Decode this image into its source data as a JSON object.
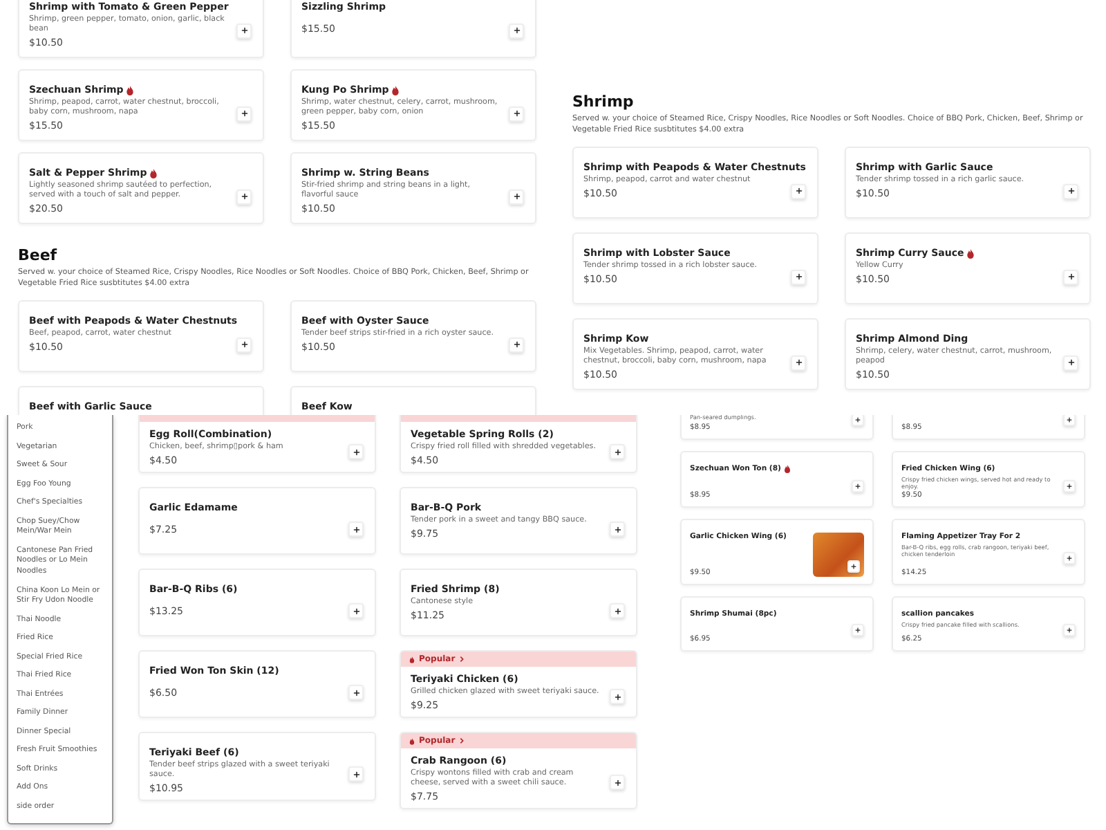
{
  "top_left": {
    "cards": [
      {
        "name": "Shrimp with Tomato & Green Pepper",
        "spicy": false,
        "description": "Shrimp, green pepper, tomato, onion, garlic, black bean",
        "price": "$10.50"
      },
      {
        "name": "Sizzling Shrimp",
        "spicy": false,
        "price": "$15.50"
      },
      {
        "name": "Szechuan Shrimp",
        "spicy": true,
        "description": "Shrimp, peapod, carrot, water chestnut, broccoli, baby corn, mushroom, napa",
        "price": "$15.50"
      },
      {
        "name": "Kung Po Shrimp",
        "spicy": true,
        "description": "Shrimp, water chestnut, celery, carrot, mushroom, green pepper, baby corn, onion",
        "price": "$15.50"
      },
      {
        "name": "Salt & Pepper Shrimp",
        "spicy": true,
        "description": "Lightly seasoned shrimp sautéed to perfection, served with a touch of salt and pepper.",
        "price": "$20.50"
      },
      {
        "name": "Shrimp w. String Beans",
        "spicy": false,
        "description": "Stir-fried shrimp and string beans in a light, flavorful sauce",
        "price": "$10.50"
      }
    ],
    "section": {
      "title": "Beef",
      "description": "Served w. your choice of Steamed Rice, Crispy Noodles, Rice Noodles or Soft Noodles. Choice of BBQ Pork, Chicken, Beef, Shrimp or Vegetable Fried Rice susbtitutes $4.00 extra",
      "cards": [
        {
          "name": "Beef with Peapods & Water Chestnuts",
          "spicy": false,
          "description": "Beef, peapod, carrot, water chestnut",
          "price": "$10.50"
        },
        {
          "name": "Beef with Oyster Sauce",
          "spicy": false,
          "description": "Tender beef strips stir-fried in a rich oyster sauce.",
          "price": "$10.50"
        },
        {
          "name": "Beef with Garlic Sauce",
          "spicy": false
        },
        {
          "name": "Beef Kow",
          "spicy": false
        }
      ]
    }
  },
  "top_right": {
    "section": {
      "title": "Shrimp",
      "description": "Served w. your choice of Steamed Rice, Crispy Noodles, Rice Noodles or Soft Noodles. Choice of BBQ Pork, Chicken, Beef, Shrimp or Vegetable Fried Rice susbtitutes $4.00 extra",
      "cards": [
        {
          "name": "Shrimp with Peapods & Water Chestnuts",
          "spicy": false,
          "description": "Shrimp, peapod, carrot and water chestnut",
          "price": "$10.50"
        },
        {
          "name": "Shrimp with Garlic Sauce",
          "spicy": false,
          "description": "Tender shrimp tossed in a rich garlic sauce.",
          "price": "$10.50"
        },
        {
          "name": "Shrimp with Lobster Sauce",
          "spicy": false,
          "description": "Tender shrimp tossed in a rich lobster sauce.",
          "price": "$10.50"
        },
        {
          "name": "Shrimp Curry Sauce",
          "spicy": true,
          "description": "Yellow Curry",
          "price": "$10.50"
        },
        {
          "name": "Shrimp Kow",
          "spicy": false,
          "description": "Mix Vegetables. Shrimp, peapod, carrot, water chestnut, broccoli, baby corn, mushroom, napa",
          "price": "$10.50"
        },
        {
          "name": "Shrimp Almond Ding",
          "spicy": false,
          "description": "Shrimp, celery, water chestnut, carrot, mushroom, peapod",
          "price": "$10.50"
        }
      ]
    }
  },
  "bottom_left": {
    "sidebar": {
      "items": [
        "Pork",
        "Vegetarian",
        "Sweet & Sour",
        "Egg Foo Young",
        "Chef's Specialties",
        "Chop Suey/Chow Mein/War Mein",
        "Cantonese Pan Fried Noodles or Lo Mein Noodles",
        "China Koon Lo Mein or Stir Fry Udon Noodle",
        "Thai Noodle",
        "Fried Rice",
        "Special Fried Rice",
        "Thai Fried Rice",
        "Thai Entrées",
        "Family Dinner",
        "Dinner Special",
        "Fresh Fruit Smoothies",
        "Soft Drinks",
        "Add Ons",
        "side order"
      ]
    },
    "cards": [
      {
        "name": "Egg Roll(Combination)",
        "spicy": false,
        "popular": true,
        "description": "Chicken, beef, shrimp▯pork & ham",
        "price": "$4.50"
      },
      {
        "name": "Garlic Edamame",
        "spicy": false,
        "popular": false,
        "price": "$7.25"
      },
      {
        "name": "Bar-B-Q Ribs (6)",
        "spicy": false,
        "popular": false,
        "price": "$13.25"
      },
      {
        "name": "Fried Won Ton Skin (12)",
        "spicy": false,
        "popular": false,
        "price": "$6.50"
      },
      {
        "name": "Teriyaki Beef (6)",
        "spicy": false,
        "popular": false,
        "description": "Tender beef strips glazed with a sweet teriyaki sauce.",
        "price": "$10.95"
      }
    ]
  },
  "bottom_middle": {
    "cards": [
      {
        "name": "Vegetable Spring Rolls (2)",
        "spicy": false,
        "popular": true,
        "description": "Crispy fried roll filled with shredded vegetables.",
        "price": "$4.50"
      },
      {
        "name": "Bar-B-Q Pork",
        "spicy": false,
        "popular": false,
        "description": "Tender pork in a sweet and tangy BBQ sauce.",
        "price": "$9.75"
      },
      {
        "name": "Fried Shrimp (8)",
        "spicy": false,
        "popular": false,
        "description": "Cantonese style",
        "price": "$11.25"
      },
      {
        "name": "Teriyaki Chicken (6)",
        "spicy": false,
        "popular": true,
        "badge": "Popular",
        "description": "Grilled chicken glazed with sweet teriyaki sauce.",
        "price": "$9.25"
      },
      {
        "name": "Crab Rangoon (6)",
        "spicy": false,
        "popular": true,
        "badge": "Popular",
        "description": "Crispy wontons filled with crab and cream cheese, served with a sweet chili sauce.",
        "price": "$7.75"
      }
    ]
  },
  "bottom_right": {
    "cards": [
      {
        "spicy": false,
        "description": "Pan-seared dumplings.",
        "price": "$8.95"
      },
      {
        "spicy": false,
        "price": "$8.95"
      },
      {
        "name": "Szechuan Won Ton (8)",
        "spicy": true,
        "price": "$8.95"
      },
      {
        "name": "Fried Chicken Wing (6)",
        "spicy": false,
        "description": "Crispy fried chicken wings, served hot and ready to enjoy.",
        "price": "$9.50"
      },
      {
        "name": "Garlic Chicken Wing (6)",
        "spicy": false,
        "photo": true,
        "price": "$9.50"
      },
      {
        "name": "Flaming Appetizer Tray For 2",
        "spicy": false,
        "description": "Bar-B-Q ribs, egg rolls, crab rangoon, teriyaki beef, chicken tenderloin",
        "price": "$14.25"
      },
      {
        "name": "Shrimp Shumai (8pc)",
        "spicy": false,
        "price": "$6.95"
      },
      {
        "name": "scallion pancakes",
        "spicy": false,
        "description": "Crispy fried pancake filled with scallions.",
        "price": "$6.25"
      }
    ]
  }
}
